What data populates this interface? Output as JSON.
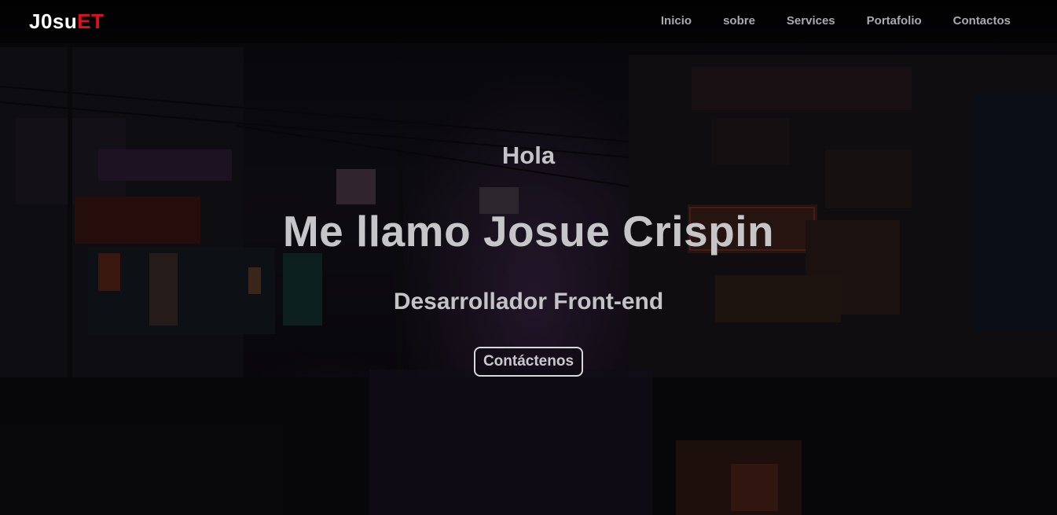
{
  "header": {
    "logo": {
      "part1": "J0su",
      "part2": "ET"
    },
    "nav": [
      "Inicio",
      "sobre",
      "Services",
      "Portafolio",
      "Contactos"
    ]
  },
  "hero": {
    "greeting": "Hola",
    "name": "Me llamo Josue Crispin",
    "role": "Desarrollador Front-end",
    "cta_label": "Contáctenos"
  },
  "colors": {
    "accent": "#e0111b",
    "text": "#c6c6c9",
    "nav_text": "#a9a9ae"
  }
}
